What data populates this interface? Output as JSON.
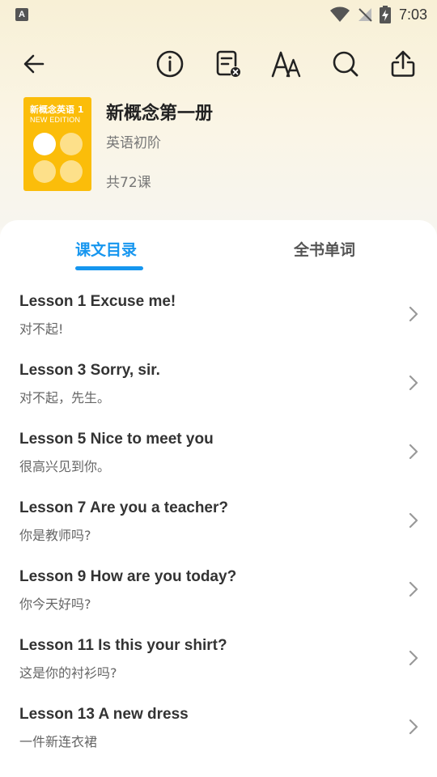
{
  "status_bar": {
    "app_icon_letter": "A",
    "time": "7:03"
  },
  "book": {
    "cover_title": "新概念英语 1",
    "cover_subtitle": "NEW EDITION",
    "title": "新概念第一册",
    "level": "英语初阶",
    "lesson_count": "共72课"
  },
  "tabs": [
    {
      "label": "课文目录",
      "active": true
    },
    {
      "label": "全书单词",
      "active": false
    }
  ],
  "lessons": [
    {
      "title": "Lesson 1 Excuse me!",
      "subtitle": "对不起!"
    },
    {
      "title": "Lesson 3 Sorry, sir.",
      "subtitle": "对不起，先生。"
    },
    {
      "title": "Lesson 5 Nice to meet you",
      "subtitle": "很高兴见到你。"
    },
    {
      "title": "Lesson 7 Are you a teacher?",
      "subtitle": "你是教师吗?"
    },
    {
      "title": "Lesson 9 How are you today?",
      "subtitle": "你今天好吗?"
    },
    {
      "title": "Lesson 11 Is this your shirt?",
      "subtitle": "这是你的衬衫吗?"
    },
    {
      "title": "Lesson 13 A new dress",
      "subtitle": "一件新连衣裙"
    }
  ],
  "colors": {
    "accent": "#1696ef",
    "cover": "#fbbd0a"
  },
  "icons": {
    "back": "arrow-left-icon",
    "info": "info-icon",
    "notes": "document-remove-icon",
    "font": "font-size-icon",
    "search": "search-icon",
    "share": "share-icon",
    "chevron": "chevron-right-icon"
  }
}
